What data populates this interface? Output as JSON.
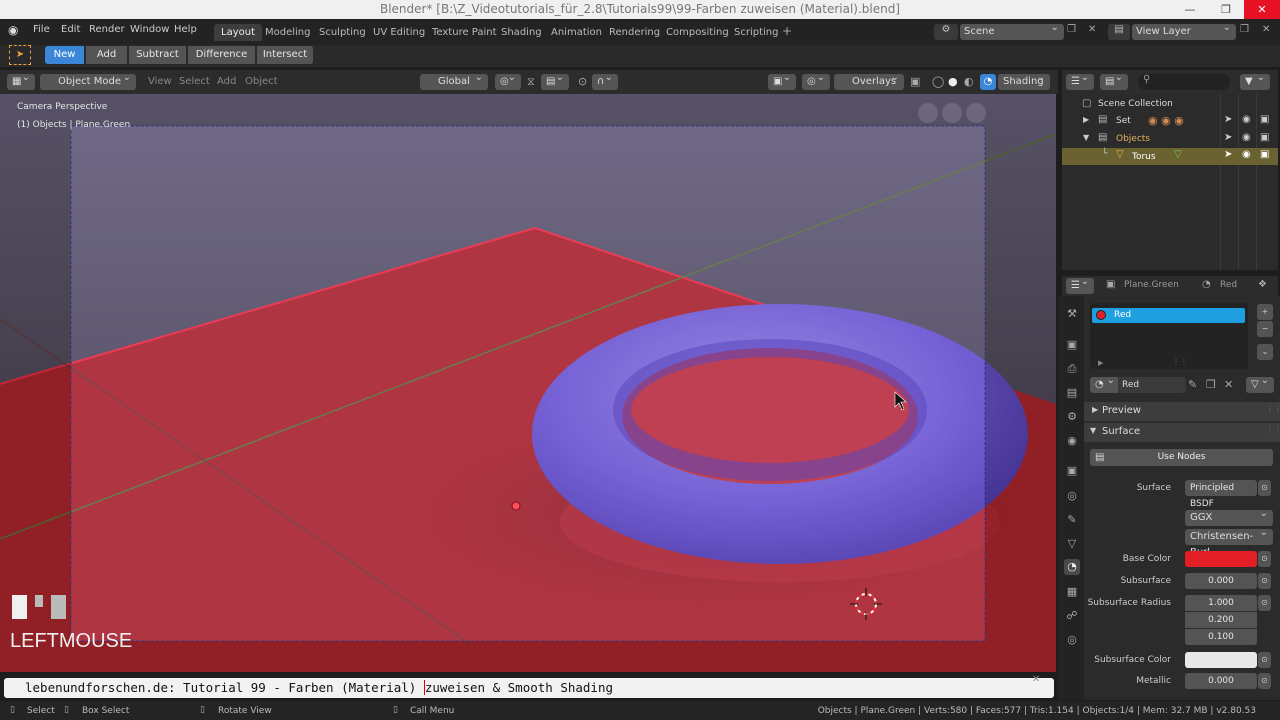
{
  "window": {
    "title": "Blender* [B:\\Z_Videotutorials_für_2.8\\Tutorials99\\99-Farben zuweisen (Material).blend]"
  },
  "menus": [
    "File",
    "Edit",
    "Render",
    "Window",
    "Help"
  ],
  "workspaces": [
    "Layout",
    "Modeling",
    "Sculpting",
    "UV Editing",
    "Texture Paint",
    "Shading",
    "Animation",
    "Rendering",
    "Compositing",
    "Scripting"
  ],
  "scene": {
    "label": "Scene",
    "view_layer": "View Layer"
  },
  "boolean_tools": [
    "New",
    "Add",
    "Subtract",
    "Difference",
    "Intersect"
  ],
  "viewport_header": {
    "mode": "Object Mode",
    "menus": [
      "View",
      "Select",
      "Add",
      "Object"
    ],
    "transform": "Global",
    "overlays": "Overlays",
    "shading": "Shading"
  },
  "viewport": {
    "camera": "Camera Perspective",
    "info": "(1) Objects | Plane.Green",
    "key": "LEFTMOUSE"
  },
  "outliner": {
    "search_placeholder": "",
    "root": "Scene Collection",
    "items": [
      {
        "name": "Set",
        "indent": 1,
        "selected": false
      },
      {
        "name": "Objects",
        "indent": 1,
        "selected": false,
        "highlight": true
      },
      {
        "name": "Torus",
        "indent": 2,
        "selected": true
      }
    ]
  },
  "properties": {
    "object": "Plane.Green",
    "material_header": "Red",
    "slot": "Red",
    "material": "Red",
    "preview": "Preview",
    "surface_panel": "Surface",
    "use_nodes": "Use Nodes",
    "rows": [
      {
        "label": "Surface",
        "value": "Principled BSDF"
      },
      {
        "label": "",
        "value": "GGX"
      },
      {
        "label": "",
        "value": "Christensen-Burl..."
      },
      {
        "label": "Base Color",
        "value": ""
      },
      {
        "label": "Subsurface",
        "value": "0.000"
      },
      {
        "label": "Subsurface Radius",
        "value": "1.000"
      },
      {
        "label": "",
        "value": "0.200"
      },
      {
        "label": "",
        "value": "0.100"
      },
      {
        "label": "Subsurface Color",
        "value": ""
      },
      {
        "label": "Metallic",
        "value": "0.000"
      }
    ],
    "base_color": "#e31e24",
    "subsurface_color": "#e8e8e8"
  },
  "caption": {
    "part1": "lebenundforschen.de: Tutorial 99 - Farben (Material) ",
    "part2": "zuweisen & Smooth Shading"
  },
  "status": {
    "select": "Select",
    "box_select": "Box Select",
    "rotate": "Rotate View",
    "call_menu": "Call Menu",
    "info": "Objects | Plane.Green | Verts:580 | Faces:577 | Tris:1.154 | Objects:1/4 | Mem: 32.7 MB | v2.80.53"
  },
  "colors": {
    "accent": "#3c86d8",
    "plane_red": "#d3222a",
    "torus_purple": "#6a52d6"
  }
}
